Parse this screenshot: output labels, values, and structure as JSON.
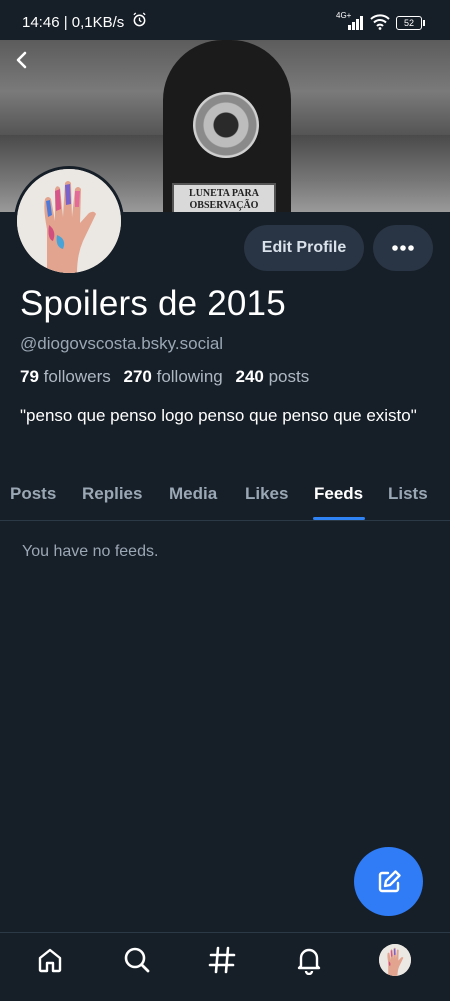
{
  "status_bar": {
    "time": "14:46 | 0,1KB/s",
    "network": "4G+",
    "battery": "52"
  },
  "banner": {
    "plate_text_1": "LUNETA PARA",
    "plate_text_2": "OBSERVAÇÃO"
  },
  "profile": {
    "display_name": "Spoilers de 2015",
    "handle": "@diogovscosta.bsky.social",
    "followers_count": "79",
    "followers_label": "followers",
    "following_count": "270",
    "following_label": "following",
    "posts_count": "240",
    "posts_label": "posts",
    "bio": "\"penso que penso logo penso que penso que existo\""
  },
  "actions": {
    "edit_profile": "Edit Profile"
  },
  "tabs": [
    {
      "label": "Posts"
    },
    {
      "label": "Replies"
    },
    {
      "label": "Media"
    },
    {
      "label": "Likes"
    },
    {
      "label": "Feeds",
      "active": true
    },
    {
      "label": "Lists"
    }
  ],
  "feeds": {
    "empty_message": "You have no feeds."
  },
  "colors": {
    "background": "#161e27",
    "accent": "#2f7cf6",
    "button": "#293544",
    "muted_text": "#9aa7b4"
  },
  "icons": {
    "back": "chevron-left-icon",
    "more": "ellipsis-icon",
    "compose": "compose-icon",
    "nav": [
      "home-icon",
      "search-icon",
      "hashtag-icon",
      "bell-icon",
      "profile-avatar"
    ]
  }
}
